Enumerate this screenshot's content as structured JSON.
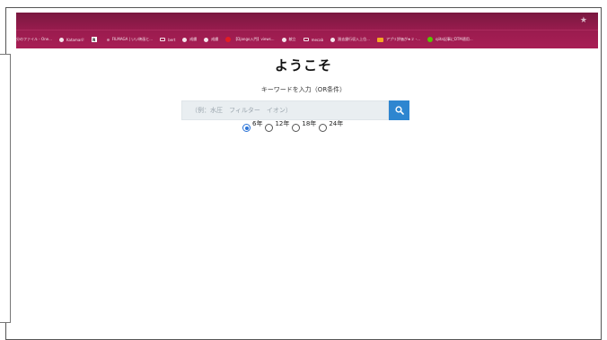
{
  "browser": {
    "bookmarks": [
      {
        "label": "分のファイル - One...",
        "icon": "none"
      },
      {
        "label": "Katamari!",
        "icon": "globe-icon"
      },
      {
        "label": "",
        "icon": "r-logo-icon"
      },
      {
        "label": "FILMAGA | いい映画と...",
        "icon": "dot-icon"
      },
      {
        "label": "bert",
        "icon": "folder-icon"
      },
      {
        "label": "成績",
        "icon": "globe-icon"
      },
      {
        "label": "成績",
        "icon": "globe-icon"
      },
      {
        "label": "【Django入門】views...",
        "icon": "red-dot-icon"
      },
      {
        "label": "献立",
        "icon": "globe-icon"
      },
      {
        "label": "mecab",
        "icon": "folder-icon"
      },
      {
        "label": "過去銀行収入上位...",
        "icon": "globe-icon"
      },
      {
        "label": "アプリ評価が★２ -...",
        "icon": "orange-app-icon"
      },
      {
        "label": "qiita記事にDTM適用...",
        "icon": "green-dot-icon"
      }
    ]
  },
  "page": {
    "title": "ようこそ",
    "search_label": "キーワードを入力（OR条件）",
    "search_placeholder": "（例：水圧　フィルター　イオン）",
    "search_value": ""
  },
  "radios": [
    {
      "label": "6年",
      "checked": true
    },
    {
      "label": "12年",
      "checked": false
    },
    {
      "label": "18年",
      "checked": false
    },
    {
      "label": "24年",
      "checked": false
    }
  ],
  "colors": {
    "browser_bar": "#9c1c4f",
    "search_button": "#2e86d0",
    "search_input_bg": "#e9eef1",
    "radio_checked": "#2a73d6"
  }
}
